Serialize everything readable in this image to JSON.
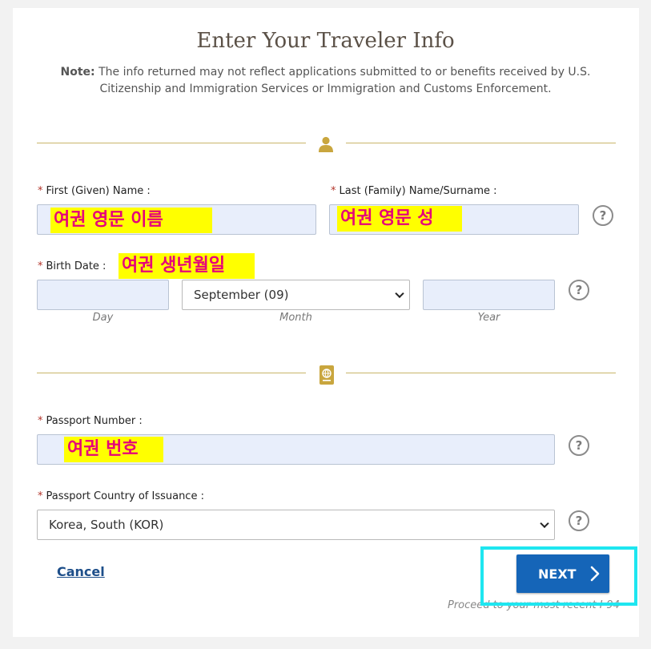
{
  "header": {
    "title": "Enter Your Traveler Info",
    "note_label": "Note:",
    "note_text": " The info returned may not reflect applications submitted to or benefits received by U.S. Citizenship and Immigration Services or Immigration and Customs Enforcement."
  },
  "icons": {
    "person": "person-icon",
    "passport": "passport-icon",
    "help": "?",
    "required": "*"
  },
  "form": {
    "first_name": {
      "label": "First (Given) Name :",
      "value": "",
      "annotation": "여권 영문 이름"
    },
    "last_name": {
      "label": "Last (Family) Name/Surname :",
      "value": "",
      "annotation": "여권 영문 성"
    },
    "birth_date": {
      "label": "Birth Date :",
      "annotation": "여권 생년월일",
      "day": {
        "value": "",
        "caption": "Day"
      },
      "month": {
        "value": "September (09)",
        "caption": "Month"
      },
      "year": {
        "value": "",
        "caption": "Year"
      }
    },
    "passport_number": {
      "label": "Passport Number :",
      "value": "",
      "annotation": "여권 번호"
    },
    "passport_country": {
      "label": "Passport Country of Issuance :",
      "value": "Korea, South (KOR)"
    }
  },
  "actions": {
    "cancel_label": "Cancel",
    "next_label": "NEXT",
    "proceed_text": "Proceed to your most recent I-94"
  },
  "colors": {
    "accent_gold": "#c9b56a",
    "primary_button": "#1565b8",
    "highlight_outline": "#1ee6f0",
    "annotation_bg": "#ffff00",
    "annotation_text": "#e6007a",
    "input_bg": "#e8eefb"
  }
}
